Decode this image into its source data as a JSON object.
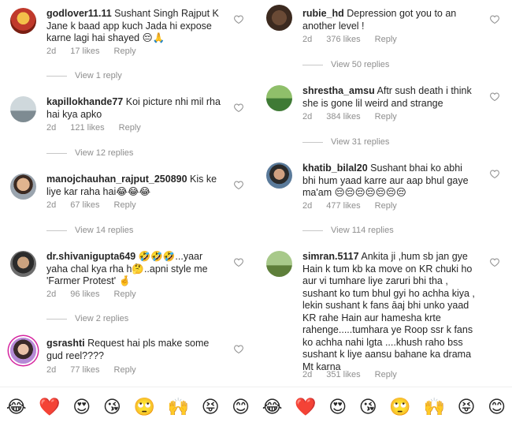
{
  "left_comments": [
    {
      "username": "godlover11.11",
      "text": "Sushant Singh Rajput K Jane k baad app kuch Jada hi expose karne lagi hai shayed 😔🙏",
      "time": "2d",
      "likes": "17 likes",
      "reply": "Reply",
      "view_replies": "View 1 reply"
    },
    {
      "username": "kapillokhande77",
      "text": "Koi picture nhi mil rha hai kya apko",
      "time": "2d",
      "likes": "121 likes",
      "reply": "Reply",
      "view_replies": "View 12 replies"
    },
    {
      "username": "manojchauhan_rajput_250890",
      "text": "Kis ke liye kar raha hai😂😂😂",
      "time": "2d",
      "likes": "67 likes",
      "reply": "Reply",
      "view_replies": "View 14 replies"
    },
    {
      "username": "dr.shivanigupta649",
      "text": "🤣🤣🤣...yaar yaha chal kya rha h🤔..apni style me 'Farmer Protest' 🤞",
      "time": "2d",
      "likes": "96 likes",
      "reply": "Reply",
      "view_replies": "View 2 replies"
    },
    {
      "username": "gsrashti",
      "text": "Request hai pls make some gud reel????",
      "time": "2d",
      "likes": "77 likes",
      "reply": "Reply"
    }
  ],
  "right_comments": [
    {
      "username": "rubie_hd",
      "text": "Depression got you to an another level !",
      "time": "2d",
      "likes": "376 likes",
      "reply": "Reply",
      "view_replies": "View 50 replies"
    },
    {
      "username": "shrestha_amsu",
      "text": "Aftr sush death i think she is gone lil weird and strange",
      "time": "2d",
      "likes": "384 likes",
      "reply": "Reply",
      "view_replies": "View 31 replies"
    },
    {
      "username": "khatib_bilal20",
      "text": "Sushant bhai ko abhi bhi hum yaad karre aur aap bhul gaye ma'am 😔😔😔😔😔😔😔",
      "time": "2d",
      "likes": "477 likes",
      "reply": "Reply",
      "view_replies": "View 114 replies"
    },
    {
      "username": "simran.5117",
      "text": "Ankita ji ,hum sb jan gye Hain k tum kb ka move on KR chuki ho aur vi tumhare liye zaruri bhi tha , sushant ko tum bhul gyi ho achha kiya , lekin sushant k fans āaj bhi unko yaad KR rahe Hain aur hamesha krte rahenge.....tumhara ye Roop ssr k fans ko achha nahi lgta ....khush raho  bss sushant k liye aansu bahane ka drama Mt karna",
      "time": "2d",
      "likes": "351 likes",
      "reply": "Reply"
    }
  ],
  "emoji_bar": [
    "😂",
    "❤️",
    "😍",
    "😘",
    "🙄",
    "🙌",
    "😝",
    "😊",
    "😂",
    "❤️",
    "😍",
    "😘",
    "🙄",
    "🙌",
    "😝",
    "😊"
  ],
  "icons": {
    "like": "heart-outline-icon"
  },
  "colors": {
    "text": "#262626",
    "meta": "#8e8e8e",
    "story_ring": "#d6249f",
    "heart_emoji": "#ed1c24"
  }
}
